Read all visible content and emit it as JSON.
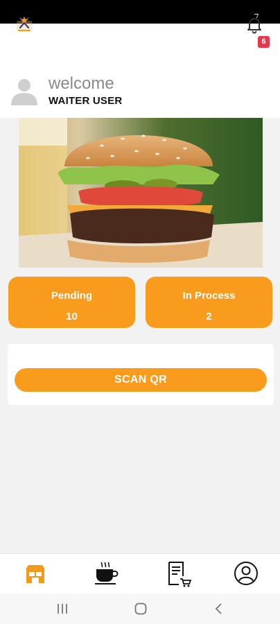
{
  "header": {
    "notification_count": "6",
    "welcome_text": "welcome",
    "user_name": "WAITER USER"
  },
  "stats": [
    {
      "label": "Pending",
      "value": "10"
    },
    {
      "label": "In Process",
      "value": "2"
    }
  ],
  "scan_button_label": "SCAN QR",
  "colors": {
    "accent": "#f99b1c",
    "badge": "#e8364a",
    "background": "#f2f2f2"
  },
  "tabbar": {
    "items": [
      {
        "icon": "store-icon",
        "active": true
      },
      {
        "icon": "coffee-cup-icon",
        "active": false
      },
      {
        "icon": "order-list-icon",
        "active": false
      },
      {
        "icon": "profile-icon",
        "active": false
      }
    ]
  },
  "system_nav": {
    "icons": [
      "recent-apps-icon",
      "home-icon",
      "back-icon"
    ]
  }
}
